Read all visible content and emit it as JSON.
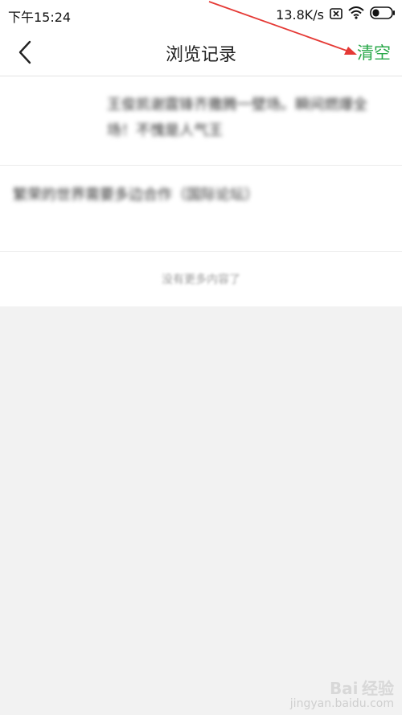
{
  "status_bar": {
    "time": "下午15:24",
    "speed": "13.8K/s",
    "icons": [
      "close-box-icon",
      "wifi-icon",
      "battery-icon"
    ]
  },
  "header": {
    "title": "浏览记录",
    "clear_label": "清空",
    "back_icon": "back-arrow-icon"
  },
  "history": {
    "items": [
      {
        "title": "王俊凯谢霆锋齐撒腾一壁场。瞬间燃爆全场！不愧是人气王"
      },
      {
        "title": "繁荣的世界需要多边合作（国际论坛）"
      }
    ],
    "end_text": "没有更多内容了"
  },
  "watermark": {
    "text1": "Bai",
    "text2": "经验",
    "text3": "jingyan.baidu.com"
  },
  "colors": {
    "accent": "#2aa84a",
    "annotation_arrow": "#e53935"
  }
}
